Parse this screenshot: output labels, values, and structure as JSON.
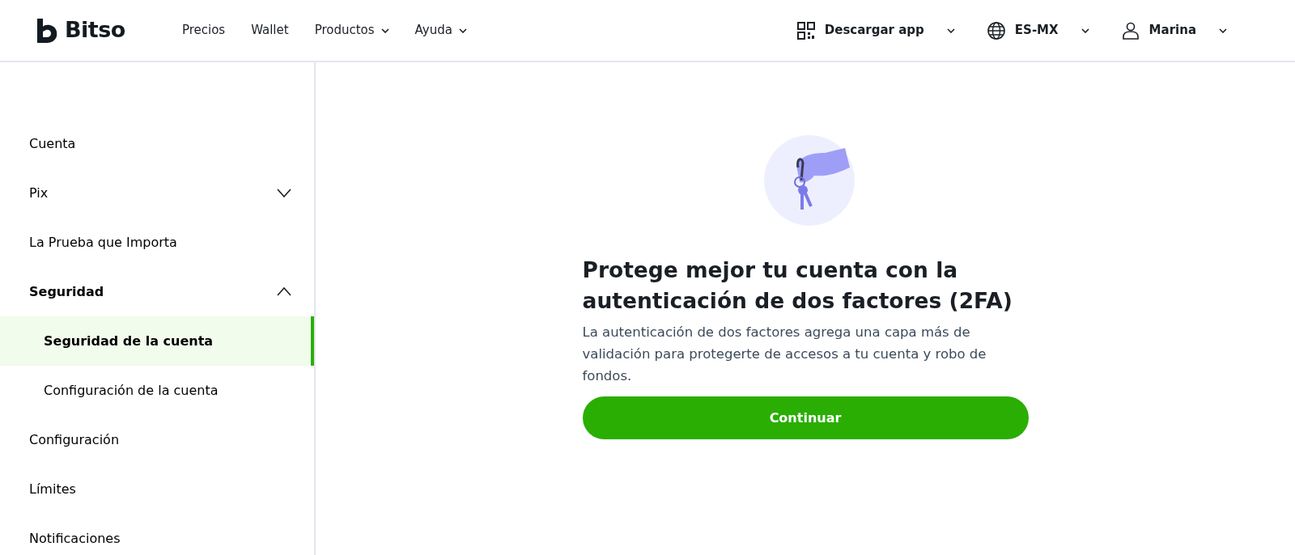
{
  "header": {
    "logo": "Bitso",
    "nav": [
      {
        "label": "Precios",
        "kind": "link"
      },
      {
        "label": "Wallet",
        "kind": "link"
      },
      {
        "label": "Productos",
        "kind": "dropdown"
      },
      {
        "label": "Ayuda",
        "kind": "dropdown"
      }
    ],
    "actions": [
      {
        "label": "Descargar app",
        "kind": "qr"
      },
      {
        "label": "ES-MX",
        "kind": "language"
      },
      {
        "label": "Marina",
        "kind": "account"
      }
    ]
  },
  "sidebar": {
    "items": [
      {
        "label": "Cuenta"
      },
      {
        "label": "Pix",
        "expanded": false
      },
      {
        "label": "La Prueba que Importa"
      },
      {
        "label": "Seguridad",
        "expanded": true,
        "children": [
          {
            "label": "Seguridad de la cuenta",
            "selected": true
          },
          {
            "label": "Configuración de la cuenta",
            "selected": false
          }
        ]
      },
      {
        "label": "Configuración"
      },
      {
        "label": "Límites"
      },
      {
        "label": "Notificaciones"
      }
    ]
  },
  "main": {
    "title": "Protege mejor tu cuenta con la autenticación de dos factores (2FA)",
    "description": "La autenticación de dos factores agrega una capa más de validación para protegerte de accesos a tu cuenta y robo de fondos.",
    "button": "Continuar"
  }
}
